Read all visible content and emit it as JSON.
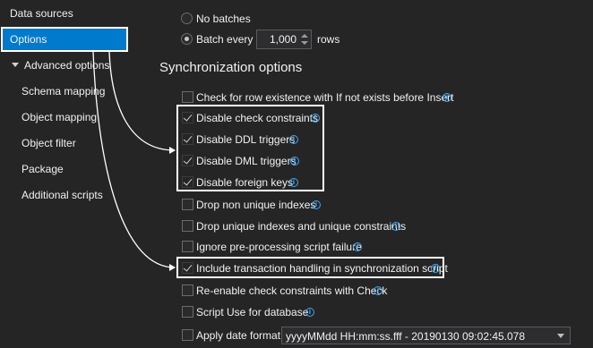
{
  "sidebar": {
    "items": [
      {
        "label": "Data sources"
      },
      {
        "label": "Options"
      },
      {
        "label": "Advanced options"
      },
      {
        "label": "Schema mapping"
      },
      {
        "label": "Object mapping"
      },
      {
        "label": "Object filter"
      },
      {
        "label": "Package"
      },
      {
        "label": "Additional scripts"
      }
    ]
  },
  "batch": {
    "no_batches_label": "No batches",
    "batch_every_label": "Batch every",
    "rows_value": "1,000",
    "rows_label": "rows"
  },
  "sync": {
    "title": "Synchronization options",
    "options": [
      {
        "label": "Check for row existence with If not exists before Insert",
        "checked": false
      },
      {
        "label": "Disable check constraints",
        "checked": true
      },
      {
        "label": "Disable DDL triggers",
        "checked": true
      },
      {
        "label": "Disable DML triggers",
        "checked": true
      },
      {
        "label": "Disable foreign keys",
        "checked": true
      },
      {
        "label": "Drop non unique indexes",
        "checked": false
      },
      {
        "label": "Drop unique indexes and unique constraints",
        "checked": false
      },
      {
        "label": "Ignore pre-processing script failure",
        "checked": false
      },
      {
        "label": "Include transaction handling in synchronization script",
        "checked": true
      },
      {
        "label": "Re-enable check constraints with Check",
        "checked": false
      },
      {
        "label": "Script Use for database",
        "checked": false
      },
      {
        "label": "Apply date format:",
        "checked": false
      }
    ],
    "date_format_value": "yyyyMMdd HH:mm:ss.fff - 20190130 09:02:45.078"
  },
  "icons": {
    "info": "i"
  },
  "colors": {
    "background": "#252526",
    "selection": "#007acc",
    "info": "#3fa7f2",
    "highlight": "#ffffff"
  }
}
